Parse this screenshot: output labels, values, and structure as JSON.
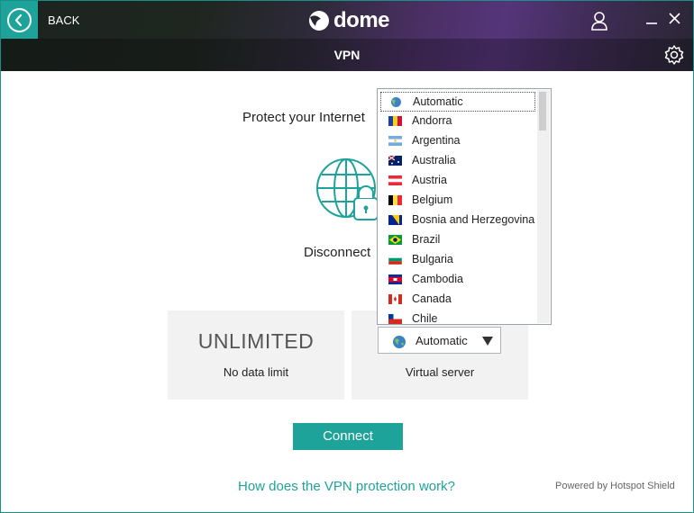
{
  "header": {
    "back_label": "BACK",
    "logo_text": "dome",
    "section_title": "VPN"
  },
  "main": {
    "protect_text": "Protect your Internet",
    "status_text": "Disconnect"
  },
  "cards": {
    "data_big": "UNLIMITED",
    "data_small": "No data limit",
    "server_small": "Virtual server"
  },
  "server_select": {
    "value": "Automatic"
  },
  "connect_label": "Connect",
  "help_link": "How does the VPN protection work?",
  "powered_by": "Powered by Hotspot Shield",
  "dropdown": {
    "selected": "Automatic",
    "items": [
      {
        "label": "Automatic",
        "icon": "globe-icon"
      },
      {
        "label": "Andorra",
        "icon": "flag-andorra-icon"
      },
      {
        "label": "Argentina",
        "icon": "flag-argentina-icon"
      },
      {
        "label": "Australia",
        "icon": "flag-australia-icon"
      },
      {
        "label": "Austria",
        "icon": "flag-austria-icon"
      },
      {
        "label": "Belgium",
        "icon": "flag-belgium-icon"
      },
      {
        "label": "Bosnia and Herzegovina",
        "icon": "flag-bosnia-icon"
      },
      {
        "label": "Brazil",
        "icon": "flag-brazil-icon"
      },
      {
        "label": "Bulgaria",
        "icon": "flag-bulgaria-icon"
      },
      {
        "label": "Cambodia",
        "icon": "flag-cambodia-icon"
      },
      {
        "label": "Canada",
        "icon": "flag-canada-icon"
      },
      {
        "label": "Chile",
        "icon": "flag-chile-icon"
      }
    ]
  },
  "colors": {
    "accent": "#1ea39a",
    "card_bg": "#f2f2f2",
    "header_purple": "#55357a"
  }
}
